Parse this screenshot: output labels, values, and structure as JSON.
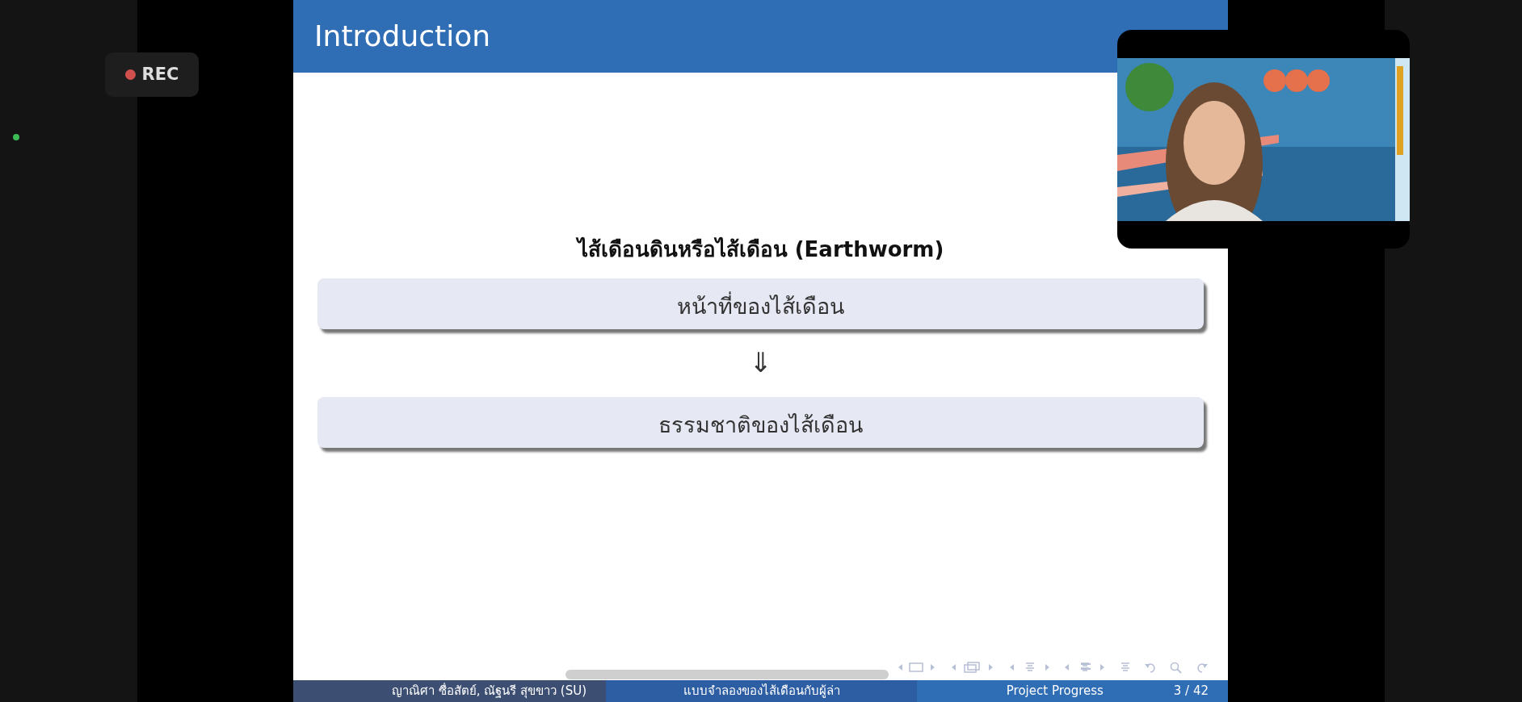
{
  "recording": {
    "label": "REC"
  },
  "slide": {
    "title": "Introduction",
    "heading": "ไส้เดือนดินหรือไส้เดือน (Earthworm)",
    "blocks": [
      "หน้าที่ของไส้เดือน",
      "ธรรมชาติของไส้เดือน"
    ],
    "arrow": "⇓",
    "footer": {
      "authors": "ญาณิศา ซื่อสัตย์, ณัฐนรี สุขขาว (SU)",
      "title": "แบบจำลองของไส้เดือนกับผู้ล่า",
      "section": "Project Progress",
      "page": "3 / 42"
    }
  }
}
